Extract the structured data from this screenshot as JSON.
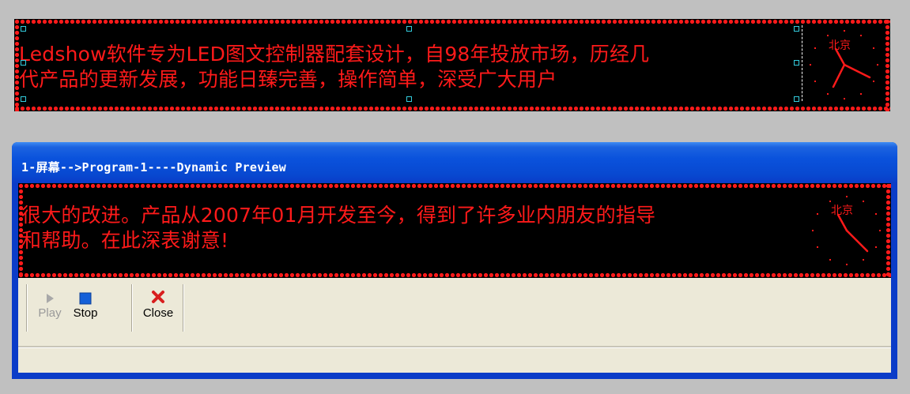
{
  "top_panel": {
    "text_line1": "Ledshow软件专为LED图文控制器配套设计，自98年投放市场，历经几",
    "text_line2": "代产品的更新发展，功能日臻完善，操作简单，深受广大用户",
    "clock_label": "北京"
  },
  "preview_window": {
    "title": "1-屏幕-->Program-1----Dynamic Preview",
    "text_line1": "很大的改进。产品从2007年01月开发至今，得到了许多业内朋友的指导",
    "text_line2": "和帮助。在此深表谢意!",
    "clock_label": "北京"
  },
  "toolbar": {
    "play_label": "Play",
    "stop_label": "Stop",
    "close_label": "Close"
  },
  "colors": {
    "led_red": "#ff1a1a",
    "titlebar_blue": "#0a52dc",
    "toolbar_bg": "#ece9d8",
    "stop_icon": "#1560d8",
    "close_icon": "#d81e1e"
  },
  "icons": [
    "play-icon",
    "stop-icon",
    "close-icon"
  ]
}
